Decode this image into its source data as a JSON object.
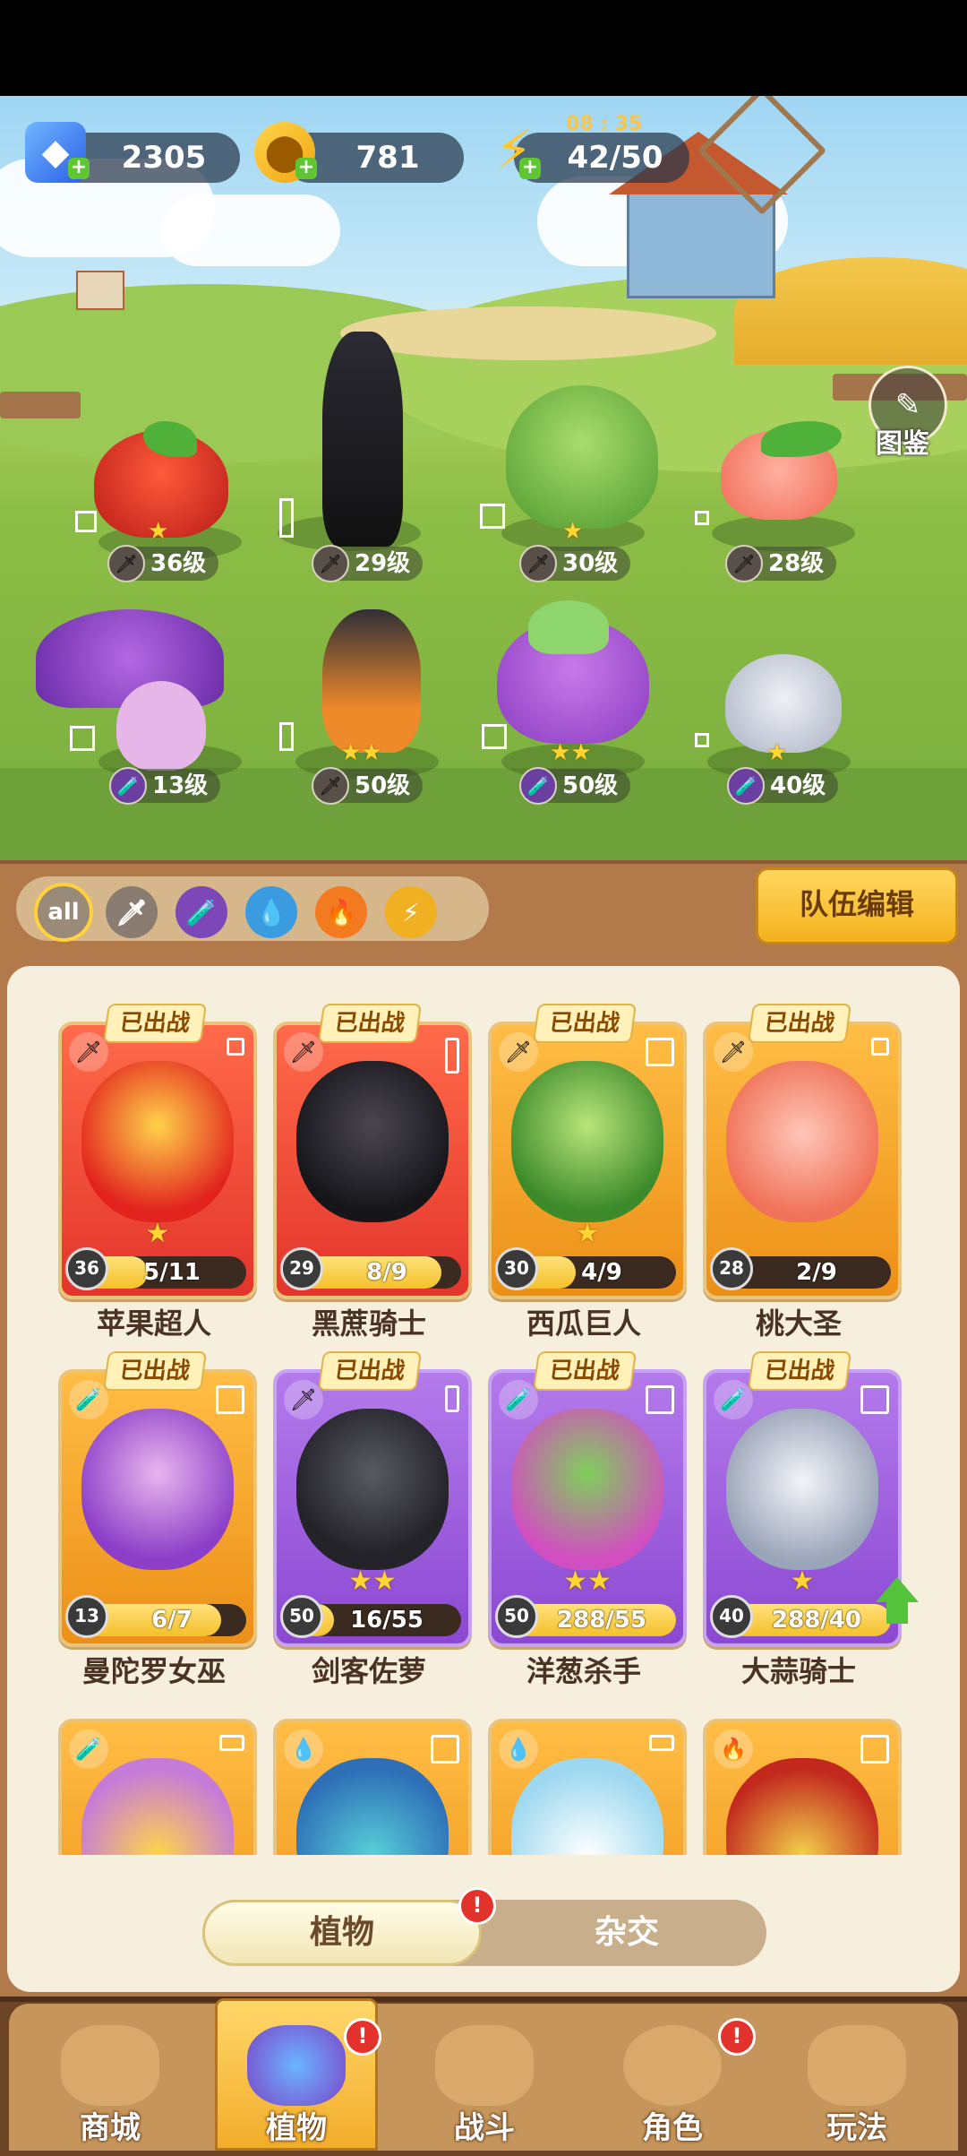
{
  "resources": {
    "gems": "2305",
    "gold": "781",
    "energy": "42/50",
    "energy_timer": "08 : 35"
  },
  "codex_label": "图鉴",
  "lineup": [
    {
      "level": "36级",
      "stars": "★",
      "element": "sword"
    },
    {
      "level": "29级",
      "stars": "",
      "element": "sword"
    },
    {
      "level": "30级",
      "stars": "★",
      "element": "sword"
    },
    {
      "level": "28级",
      "stars": "",
      "element": "sword"
    },
    {
      "level": "13级",
      "stars": "",
      "element": "potion"
    },
    {
      "level": "50级",
      "stars": "★★",
      "element": "sword"
    },
    {
      "level": "50级",
      "stars": "★★",
      "element": "potion"
    },
    {
      "level": "40级",
      "stars": "★",
      "element": "potion"
    }
  ],
  "filters": {
    "all": "all",
    "items": [
      "sword-icon",
      "potion-icon",
      "water-icon",
      "fire-icon",
      "lightning-icon"
    ]
  },
  "team_edit_label": "队伍编辑",
  "deployed_label": "已出战",
  "cards": [
    {
      "name": "苹果超人",
      "level": "36",
      "progress": "5/11",
      "progress_ratio": 0.45,
      "stars": "★",
      "rarity": "red",
      "element": "🗡"
    },
    {
      "name": "黑蔗骑士",
      "level": "29",
      "progress": "8/9",
      "progress_ratio": 0.89,
      "stars": "",
      "rarity": "red",
      "element": "🗡"
    },
    {
      "name": "西瓜巨人",
      "level": "30",
      "progress": "4/9",
      "progress_ratio": 0.44,
      "stars": "★",
      "rarity": "orange",
      "element": "🗡"
    },
    {
      "name": "桃大圣",
      "level": "28",
      "progress": "2/9",
      "progress_ratio": 0.22,
      "stars": "",
      "rarity": "orange",
      "element": "🗡"
    },
    {
      "name": "曼陀罗女巫",
      "level": "13",
      "progress": "6/7",
      "progress_ratio": 0.86,
      "stars": "",
      "rarity": "orange",
      "element": "🧪"
    },
    {
      "name": "剑客佐萝",
      "level": "50",
      "progress": "16/55",
      "progress_ratio": 0.29,
      "stars": "★★",
      "rarity": "purple",
      "element": "🗡"
    },
    {
      "name": "洋葱杀手",
      "level": "50",
      "progress": "288/55",
      "progress_ratio": 1.0,
      "stars": "★★",
      "rarity": "purple",
      "element": "🧪"
    },
    {
      "name": "大蒜骑士",
      "level": "40",
      "progress": "288/40",
      "progress_ratio": 1.0,
      "stars": "★",
      "rarity": "purple",
      "element": "🧪"
    }
  ],
  "partial_cards": [
    {
      "rarity": "orange",
      "element": "🧪"
    },
    {
      "rarity": "orange",
      "element": "💧"
    },
    {
      "rarity": "orange",
      "element": "💧"
    },
    {
      "rarity": "orange",
      "element": "🔥"
    }
  ],
  "toggle": {
    "left": "植物",
    "right": "杂交",
    "left_badge": "!"
  },
  "nav": [
    {
      "label": "商城",
      "badge": ""
    },
    {
      "label": "植物",
      "badge": "!"
    },
    {
      "label": "战斗",
      "badge": ""
    },
    {
      "label": "角色",
      "badge": "!"
    },
    {
      "label": "玩法",
      "badge": ""
    }
  ],
  "colors": {
    "gold": "#f5c02b",
    "red_card": "#e3352c",
    "purple_card": "#8b48d2",
    "orange_card": "#ec8f17"
  }
}
